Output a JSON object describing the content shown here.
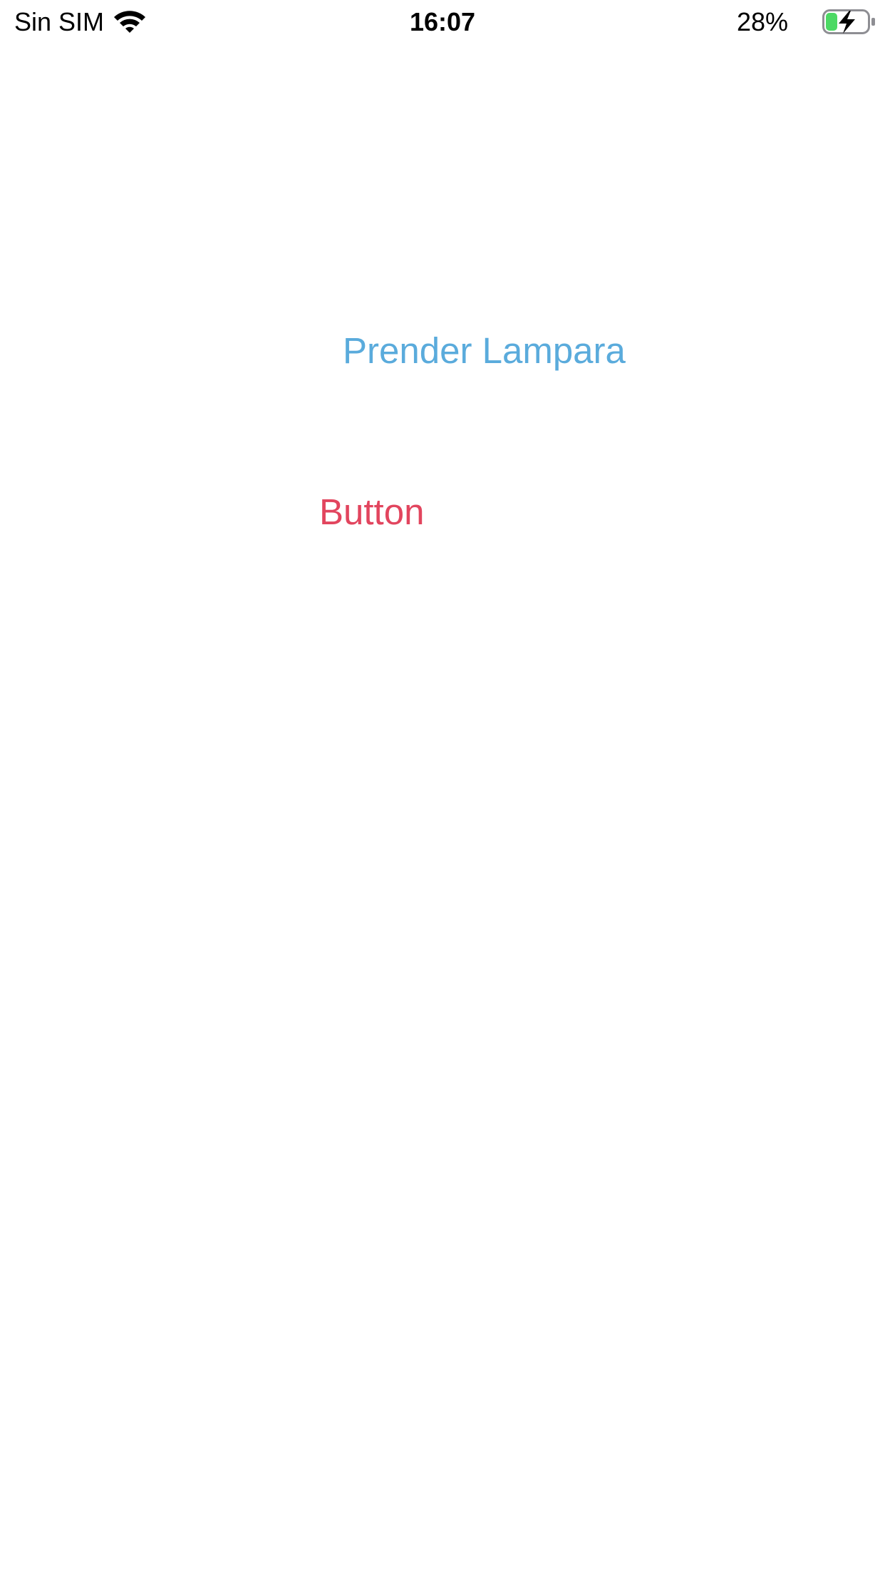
{
  "status_bar": {
    "carrier": "Sin SIM",
    "time": "16:07",
    "battery_percent": "28%",
    "icons": {
      "wifi": "wifi-icon",
      "battery": "battery-charging-icon"
    },
    "battery_level": 0.28,
    "battery_fill_color": "#4CD964"
  },
  "main": {
    "prender_button": {
      "label": "Prender Lampara",
      "color": "#5AABDC"
    },
    "second_button": {
      "label": "Button",
      "color": "#E2455E"
    }
  }
}
